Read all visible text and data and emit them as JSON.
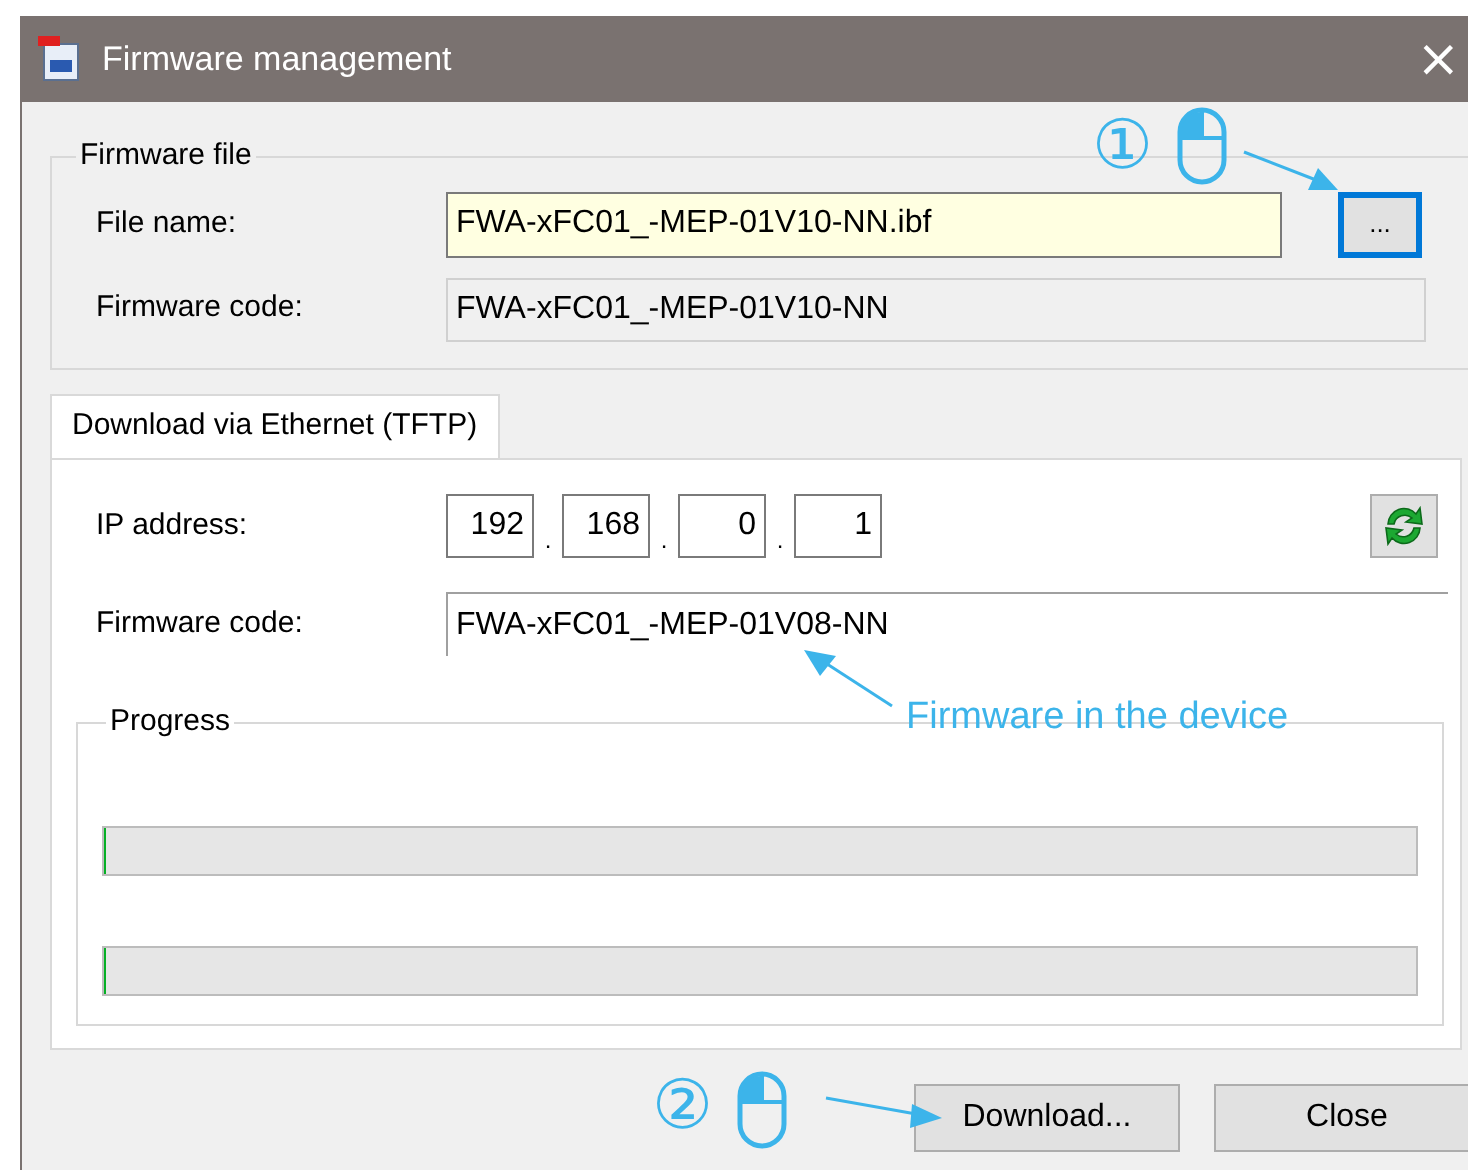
{
  "window": {
    "title": "Firmware management",
    "close": "×"
  },
  "firmware_file": {
    "title": "Firmware file",
    "file_name": {
      "label": "File name:",
      "value": "FWA-xFC01_-MEP-01V10-NN.ibf"
    },
    "browse_button": {
      "label": "...",
      "focused": true
    },
    "firmware_code": {
      "label": "Firmware code:",
      "value": "FWA-xFC01_-MEP-01V10-NN"
    }
  },
  "tabs": [
    {
      "label": "Download via Ethernet (TFTP)",
      "selected": true
    }
  ],
  "ethernet": {
    "ip_label": "IP address:",
    "ip_octets": [
      "192",
      "168",
      "0",
      "1"
    ],
    "ip_separators": [
      ".",
      ".",
      "."
    ],
    "firmware_code": {
      "label": "Firmware code:",
      "value": "FWA-xFC01_-MEP-01V08-NN"
    },
    "progress": {
      "title": "Progress",
      "bars": [
        {
          "level": 0
        },
        {
          "level": 0
        }
      ]
    }
  },
  "buttons": [
    {
      "label": "Download..."
    },
    {
      "label": "Close"
    }
  ],
  "annotations": [
    {
      "kind": "step",
      "number": "①"
    },
    {
      "kind": "step",
      "number": "②"
    },
    {
      "kind": "note",
      "text": "Firmware in the device"
    }
  ]
}
